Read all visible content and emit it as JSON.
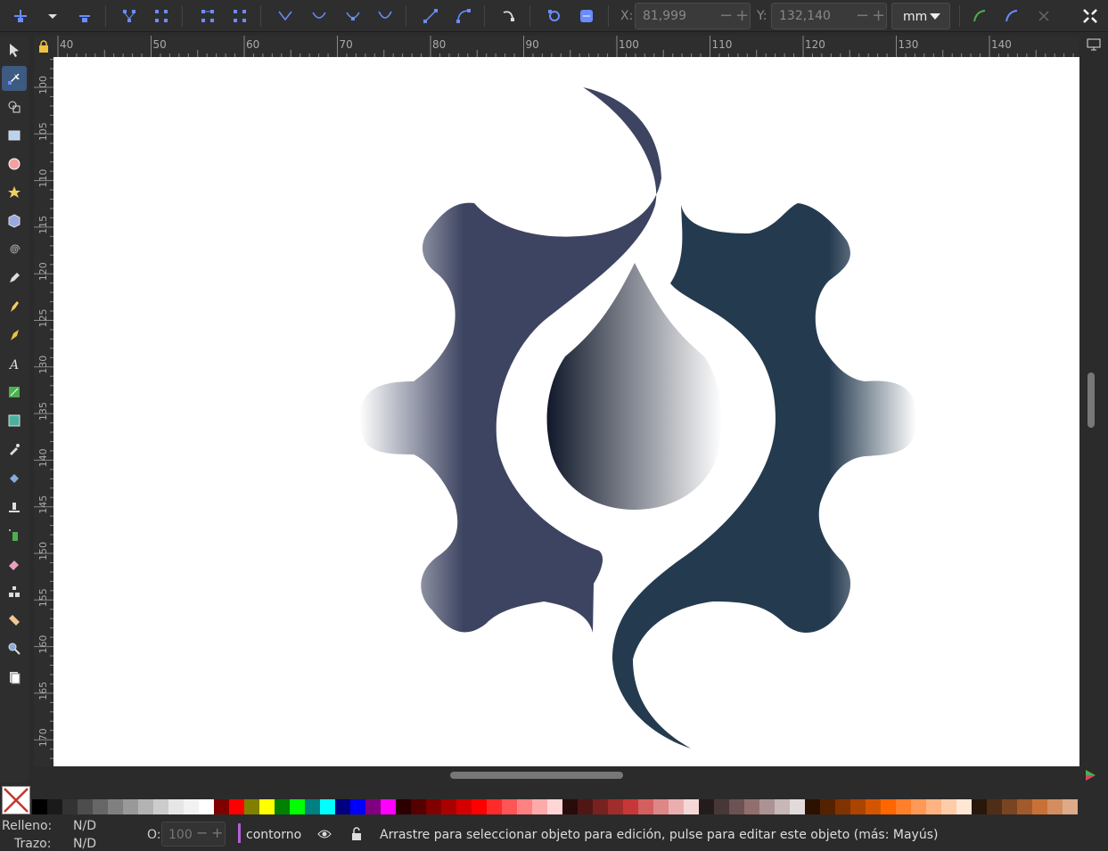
{
  "toolbar": {
    "x_label": "X:",
    "x_value": "81,999",
    "y_label": "Y:",
    "y_value": "132,140",
    "unit": "mm"
  },
  "ruler_top": [
    "40",
    "50",
    "60",
    "70",
    "80",
    "90",
    "100",
    "110",
    "120",
    "130",
    "140"
  ],
  "ruler_left": [
    "100",
    "105",
    "110",
    "115",
    "120",
    "125",
    "130",
    "135",
    "140",
    "145",
    "150",
    "155",
    "160",
    "165",
    "170"
  ],
  "status": {
    "fill_label": "Relleno:",
    "fill_value": "N/D",
    "stroke_label": "Trazo:",
    "stroke_value": "N/D",
    "opacity_label": "O:",
    "opacity_value": "100",
    "layer": "contorno",
    "message": "Arrastre para seleccionar objeto para edición, pulse para editar este objeto (más: Mayús)"
  },
  "palette": [
    "#000000",
    "#1a1a1a",
    "#333333",
    "#4d4d4d",
    "#666666",
    "#808080",
    "#999999",
    "#b3b3b3",
    "#cccccc",
    "#e6e6e6",
    "#f2f2f2",
    "#ffffff",
    "#800000",
    "#ff0000",
    "#808000",
    "#ffff00",
    "#008000",
    "#00ff00",
    "#008080",
    "#00ffff",
    "#000080",
    "#0000ff",
    "#800080",
    "#ff00ff",
    "#2b0000",
    "#550000",
    "#800000",
    "#aa0000",
    "#d40000",
    "#ff0000",
    "#ff2a2a",
    "#ff5555",
    "#ff8080",
    "#ffaaaa",
    "#ffd5d5",
    "#280b0b",
    "#501616",
    "#782121",
    "#a02c2c",
    "#c83737",
    "#d35f5f",
    "#de8787",
    "#e9afaf",
    "#f4d7d7",
    "#241c1c",
    "#483737",
    "#6c5353",
    "#916f6f",
    "#ac9393",
    "#c8b7b7",
    "#e3dbdb",
    "#2b1100",
    "#552200",
    "#803300",
    "#aa4400",
    "#d45500",
    "#ff6600",
    "#ff7f2a",
    "#ff9955",
    "#ffb380",
    "#ffccaa",
    "#ffe6d5",
    "#28170b",
    "#502d16",
    "#784421",
    "#a05a2c",
    "#c87137",
    "#d38d5f",
    "#deaa87"
  ]
}
